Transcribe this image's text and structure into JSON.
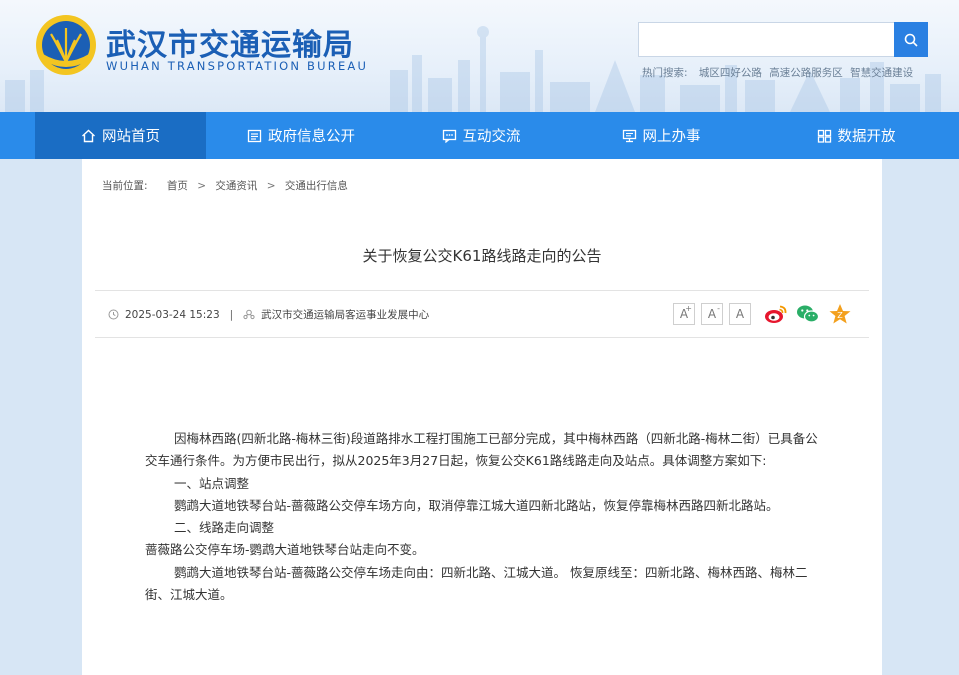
{
  "header": {
    "logo_cn": "武汉市交通运输局",
    "logo_en": "WUHAN TRANSPORTATION BUREAU",
    "search_placeholder": "",
    "hot_label": "热门搜索:",
    "hot_links": [
      "城区四好公路",
      "高速公路服务区",
      "智慧交通建设"
    ]
  },
  "nav": {
    "items": [
      {
        "label": "网站首页",
        "icon": "home-icon"
      },
      {
        "label": "政府信息公开",
        "icon": "list-icon"
      },
      {
        "label": "互动交流",
        "icon": "chat-icon"
      },
      {
        "label": "网上办事",
        "icon": "desk-icon"
      },
      {
        "label": "数据开放",
        "icon": "grid-icon"
      }
    ]
  },
  "breadcrumb": {
    "prefix": "当前位置:",
    "items": [
      "首页",
      "交通资讯",
      "交通出行信息"
    ],
    "separator": ">"
  },
  "article": {
    "title": "关于恢复公交K61路线路走向的公告",
    "date": "2025-03-24 15:23",
    "meta_divider": "|",
    "source": "武汉市交通运输局客运事业发展中心",
    "font_sizes": [
      "A",
      "A",
      "A"
    ],
    "font_sups": [
      "+",
      "-",
      ""
    ],
    "share": [
      "weibo-icon",
      "wechat-icon",
      "favorite-icon"
    ],
    "paragraphs": [
      "因梅林西路(四新北路-梅林三街)段道路排水工程打围施工已部分完成，其中梅林西路（四新北路-梅林二街）已具备公交车通行条件。为方便市民出行，拟从2025年3月27日起，恢复公交K61路线路走向及站点。具体调整方案如下:",
      "一、站点调整",
      "鹦鹉大道地铁琴台站-蔷薇路公交停车场方向，取消停靠江城大道四新北路站，恢复停靠梅林西路四新北路站。",
      "二、线路走向调整",
      "蔷薇路公交停车场-鹦鹉大道地铁琴台站走向不变。",
      "鹦鹉大道地铁琴台站-蔷薇路公交停车场走向由：四新北路、江城大道。 恢复原线至：四新北路、梅林西路、梅林二街、江城大道。"
    ]
  },
  "colors": {
    "brand_blue": "#1b5fb5",
    "nav_blue": "#2a8bea",
    "nav_active": "#1a6dc4",
    "search_btn": "#2a80e2"
  }
}
